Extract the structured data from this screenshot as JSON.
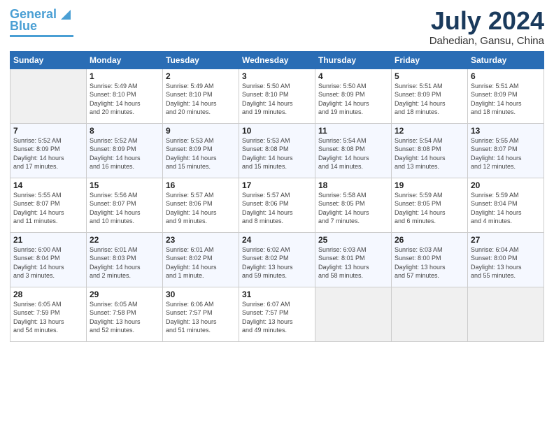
{
  "header": {
    "logo_line1": "General",
    "logo_line2": "Blue",
    "month_title": "July 2024",
    "subtitle": "Dahedian, Gansu, China"
  },
  "days_of_week": [
    "Sunday",
    "Monday",
    "Tuesday",
    "Wednesday",
    "Thursday",
    "Friday",
    "Saturday"
  ],
  "weeks": [
    [
      {
        "day": "",
        "info": ""
      },
      {
        "day": "1",
        "info": "Sunrise: 5:49 AM\nSunset: 8:10 PM\nDaylight: 14 hours\nand 20 minutes."
      },
      {
        "day": "2",
        "info": "Sunrise: 5:49 AM\nSunset: 8:10 PM\nDaylight: 14 hours\nand 20 minutes."
      },
      {
        "day": "3",
        "info": "Sunrise: 5:50 AM\nSunset: 8:10 PM\nDaylight: 14 hours\nand 19 minutes."
      },
      {
        "day": "4",
        "info": "Sunrise: 5:50 AM\nSunset: 8:09 PM\nDaylight: 14 hours\nand 19 minutes."
      },
      {
        "day": "5",
        "info": "Sunrise: 5:51 AM\nSunset: 8:09 PM\nDaylight: 14 hours\nand 18 minutes."
      },
      {
        "day": "6",
        "info": "Sunrise: 5:51 AM\nSunset: 8:09 PM\nDaylight: 14 hours\nand 18 minutes."
      }
    ],
    [
      {
        "day": "7",
        "info": "Sunrise: 5:52 AM\nSunset: 8:09 PM\nDaylight: 14 hours\nand 17 minutes."
      },
      {
        "day": "8",
        "info": "Sunrise: 5:52 AM\nSunset: 8:09 PM\nDaylight: 14 hours\nand 16 minutes."
      },
      {
        "day": "9",
        "info": "Sunrise: 5:53 AM\nSunset: 8:09 PM\nDaylight: 14 hours\nand 15 minutes."
      },
      {
        "day": "10",
        "info": "Sunrise: 5:53 AM\nSunset: 8:08 PM\nDaylight: 14 hours\nand 15 minutes."
      },
      {
        "day": "11",
        "info": "Sunrise: 5:54 AM\nSunset: 8:08 PM\nDaylight: 14 hours\nand 14 minutes."
      },
      {
        "day": "12",
        "info": "Sunrise: 5:54 AM\nSunset: 8:08 PM\nDaylight: 14 hours\nand 13 minutes."
      },
      {
        "day": "13",
        "info": "Sunrise: 5:55 AM\nSunset: 8:07 PM\nDaylight: 14 hours\nand 12 minutes."
      }
    ],
    [
      {
        "day": "14",
        "info": "Sunrise: 5:55 AM\nSunset: 8:07 PM\nDaylight: 14 hours\nand 11 minutes."
      },
      {
        "day": "15",
        "info": "Sunrise: 5:56 AM\nSunset: 8:07 PM\nDaylight: 14 hours\nand 10 minutes."
      },
      {
        "day": "16",
        "info": "Sunrise: 5:57 AM\nSunset: 8:06 PM\nDaylight: 14 hours\nand 9 minutes."
      },
      {
        "day": "17",
        "info": "Sunrise: 5:57 AM\nSunset: 8:06 PM\nDaylight: 14 hours\nand 8 minutes."
      },
      {
        "day": "18",
        "info": "Sunrise: 5:58 AM\nSunset: 8:05 PM\nDaylight: 14 hours\nand 7 minutes."
      },
      {
        "day": "19",
        "info": "Sunrise: 5:59 AM\nSunset: 8:05 PM\nDaylight: 14 hours\nand 6 minutes."
      },
      {
        "day": "20",
        "info": "Sunrise: 5:59 AM\nSunset: 8:04 PM\nDaylight: 14 hours\nand 4 minutes."
      }
    ],
    [
      {
        "day": "21",
        "info": "Sunrise: 6:00 AM\nSunset: 8:04 PM\nDaylight: 14 hours\nand 3 minutes."
      },
      {
        "day": "22",
        "info": "Sunrise: 6:01 AM\nSunset: 8:03 PM\nDaylight: 14 hours\nand 2 minutes."
      },
      {
        "day": "23",
        "info": "Sunrise: 6:01 AM\nSunset: 8:02 PM\nDaylight: 14 hours\nand 1 minute."
      },
      {
        "day": "24",
        "info": "Sunrise: 6:02 AM\nSunset: 8:02 PM\nDaylight: 13 hours\nand 59 minutes."
      },
      {
        "day": "25",
        "info": "Sunrise: 6:03 AM\nSunset: 8:01 PM\nDaylight: 13 hours\nand 58 minutes."
      },
      {
        "day": "26",
        "info": "Sunrise: 6:03 AM\nSunset: 8:00 PM\nDaylight: 13 hours\nand 57 minutes."
      },
      {
        "day": "27",
        "info": "Sunrise: 6:04 AM\nSunset: 8:00 PM\nDaylight: 13 hours\nand 55 minutes."
      }
    ],
    [
      {
        "day": "28",
        "info": "Sunrise: 6:05 AM\nSunset: 7:59 PM\nDaylight: 13 hours\nand 54 minutes."
      },
      {
        "day": "29",
        "info": "Sunrise: 6:05 AM\nSunset: 7:58 PM\nDaylight: 13 hours\nand 52 minutes."
      },
      {
        "day": "30",
        "info": "Sunrise: 6:06 AM\nSunset: 7:57 PM\nDaylight: 13 hours\nand 51 minutes."
      },
      {
        "day": "31",
        "info": "Sunrise: 6:07 AM\nSunset: 7:57 PM\nDaylight: 13 hours\nand 49 minutes."
      },
      {
        "day": "",
        "info": ""
      },
      {
        "day": "",
        "info": ""
      },
      {
        "day": "",
        "info": ""
      }
    ]
  ]
}
